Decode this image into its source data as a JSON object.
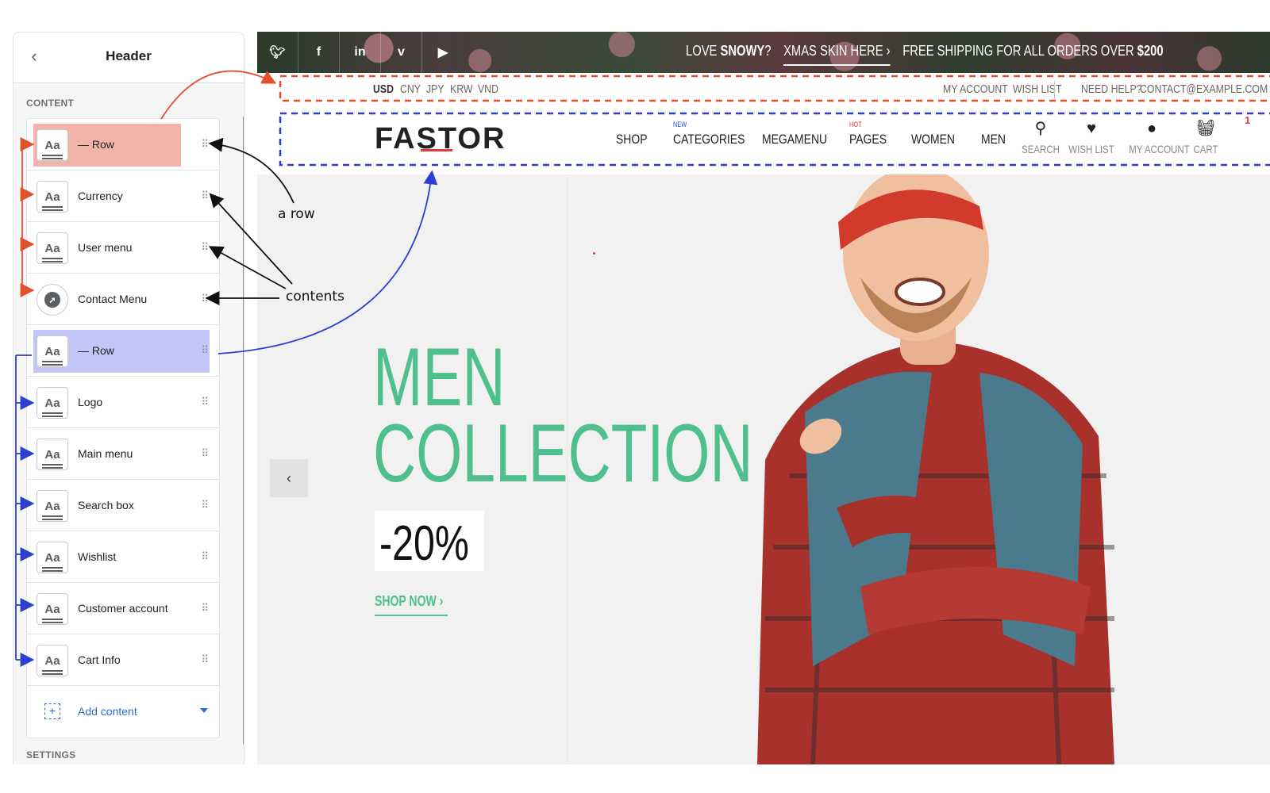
{
  "panel": {
    "title": "Header",
    "back_icon": "chevron-left-icon",
    "section_content": "CONTENT",
    "section_settings": "SETTINGS",
    "items": [
      {
        "label": "— Row",
        "icon": "text-icon",
        "highlight": "#f2b4a8"
      },
      {
        "label": "Currency",
        "icon": "text-icon"
      },
      {
        "label": "User menu",
        "icon": "text-icon"
      },
      {
        "label": "Contact Menu",
        "icon": "compass-icon"
      },
      {
        "label": "— Row",
        "icon": "text-icon",
        "highlight": "#c1c6f7"
      },
      {
        "label": "Logo",
        "icon": "text-icon"
      },
      {
        "label": "Main menu",
        "icon": "text-icon"
      },
      {
        "label": "Search box",
        "icon": "text-icon"
      },
      {
        "label": "Wishlist",
        "icon": "text-icon"
      },
      {
        "label": "Customer account",
        "icon": "text-icon"
      },
      {
        "label": "Cart Info",
        "icon": "text-icon"
      }
    ],
    "add_content": "Add content"
  },
  "annotations": {
    "a_row": "a row",
    "contents": "contents"
  },
  "store": {
    "social": [
      "twitter-icon",
      "facebook-icon",
      "linkedin-icon",
      "vimeo-icon",
      "youtube-icon"
    ],
    "promo": {
      "love": "LOVE",
      "snowy": "SNOWY",
      "q": "?",
      "skin": "XMAS SKIN HERE",
      "shipping": "FREE SHIPPING FOR ALL ORDERS OVER",
      "amount": "$200"
    },
    "currencies": [
      "USD",
      "CNY",
      "JPY",
      "KRW",
      "VND"
    ],
    "selected_currency": "USD",
    "user_menu": [
      "MY ACCOUNT",
      "WISH LIST"
    ],
    "contact": {
      "help": "NEED HELP?",
      "email": "CONTACT@EXAMPLE.COM"
    },
    "logo": "FASTOR",
    "nav": [
      {
        "label": "SHOP"
      },
      {
        "label": "CATEGORIES",
        "tag": "NEW",
        "tag_color": "#2c4bd6"
      },
      {
        "label": "MEGAMENU"
      },
      {
        "label": "PAGES",
        "tag": "HOT",
        "tag_color": "#e03a3a"
      },
      {
        "label": "WOMEN"
      },
      {
        "label": "MEN"
      }
    ],
    "tools": [
      {
        "label": "SEARCH",
        "icon": "search-icon"
      },
      {
        "label": "WISH LIST",
        "icon": "heart-icon"
      },
      {
        "label": "MY ACCOUNT",
        "icon": "user-icon"
      },
      {
        "label": "CART",
        "icon": "cart-icon"
      }
    ],
    "cart_count": "1",
    "hero": {
      "line1": "MEN",
      "line2": "COLLECTION",
      "discount": "-20%",
      "cta": "SHOP NOW",
      "accent": "#4fc08d"
    }
  },
  "colors": {
    "red_annotation": "#e2512c",
    "blue_annotation": "#2d3fd1"
  }
}
